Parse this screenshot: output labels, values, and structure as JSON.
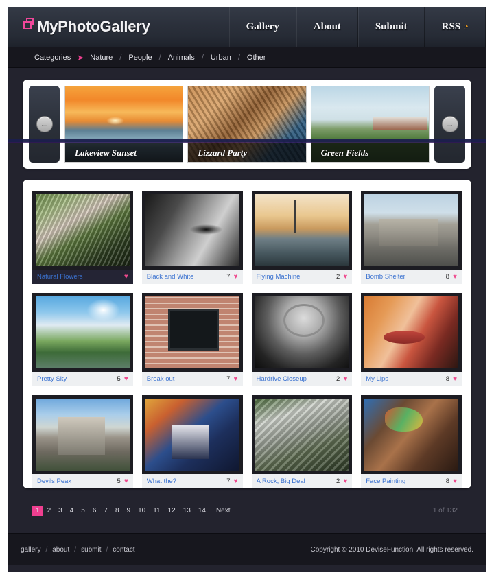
{
  "site": {
    "logo_text": "MyPhotoGallery",
    "logo_icon": "stacked-squares-icon"
  },
  "topnav": [
    {
      "label": "Gallery",
      "icon": null
    },
    {
      "label": "About",
      "icon": null
    },
    {
      "label": "Submit",
      "icon": null
    },
    {
      "label": "RSS",
      "icon": "rss-icon",
      "icon_glyph": "◔"
    }
  ],
  "categories": {
    "label": "Categories",
    "arrow_icon": "arrow-right-icon",
    "items": [
      "Nature",
      "People",
      "Animals",
      "Urban",
      "Other"
    ],
    "separator": "/"
  },
  "slider": {
    "prev_icon": "arrow-left-icon",
    "next_icon": "arrow-right-icon",
    "prev_glyph": "←",
    "next_glyph": "→",
    "slides": [
      {
        "title": "Lakeview Sunset",
        "art": "sky-sunset"
      },
      {
        "title": "Lizzard Party",
        "art": "rock-liz"
      },
      {
        "title": "Green Fields",
        "art": "green-f"
      }
    ]
  },
  "gallery": {
    "heart_glyph": "♥",
    "rows": [
      [
        {
          "title": "Natural Flowers",
          "likes": "",
          "art": "a-flowers",
          "active": true
        },
        {
          "title": "Black and White",
          "likes": "7",
          "art": "a-bw",
          "active": false
        },
        {
          "title": "Flying Machine",
          "likes": "2",
          "art": "a-boat",
          "active": false
        },
        {
          "title": "Bomb Shelter",
          "likes": "8",
          "art": "a-bunker",
          "active": false
        }
      ],
      [
        {
          "title": "Pretty Sky",
          "likes": "5",
          "art": "a-sky",
          "active": false
        },
        {
          "title": "Break out",
          "likes": "7",
          "art": "a-brick",
          "active": false
        },
        {
          "title": "Hardrive Closeup",
          "likes": "2",
          "art": "a-hdd",
          "active": false
        },
        {
          "title": "My Lips",
          "likes": "8",
          "art": "a-lips",
          "active": false
        }
      ],
      [
        {
          "title": "Devils Peak",
          "likes": "5",
          "art": "a-devils",
          "active": false
        },
        {
          "title": "What the?",
          "likes": "7",
          "art": "a-what",
          "active": false
        },
        {
          "title": "A Rock, Big Deal",
          "likes": "2",
          "art": "a-rock",
          "active": false
        },
        {
          "title": "Face Painting",
          "likes": "8",
          "art": "a-face",
          "active": false
        }
      ]
    ]
  },
  "pagination": {
    "pages": [
      "1",
      "2",
      "3",
      "4",
      "5",
      "6",
      "7",
      "8",
      "9",
      "10",
      "11",
      "12",
      "13",
      "14"
    ],
    "current": "1",
    "next_label": "Next",
    "total_label": "1 of 132"
  },
  "footer": {
    "links": [
      "gallery",
      "about",
      "submit",
      "contact"
    ],
    "separator": "/",
    "copyright": "Copyright © 2010 DeviseFunction. All rights reserved."
  },
  "colors": {
    "accent_pink": "#ef3f90",
    "link_blue": "#3b72d0",
    "page_dark": "#23232e",
    "bar_dark": "#17171e",
    "rss_orange": "#e8991f"
  }
}
